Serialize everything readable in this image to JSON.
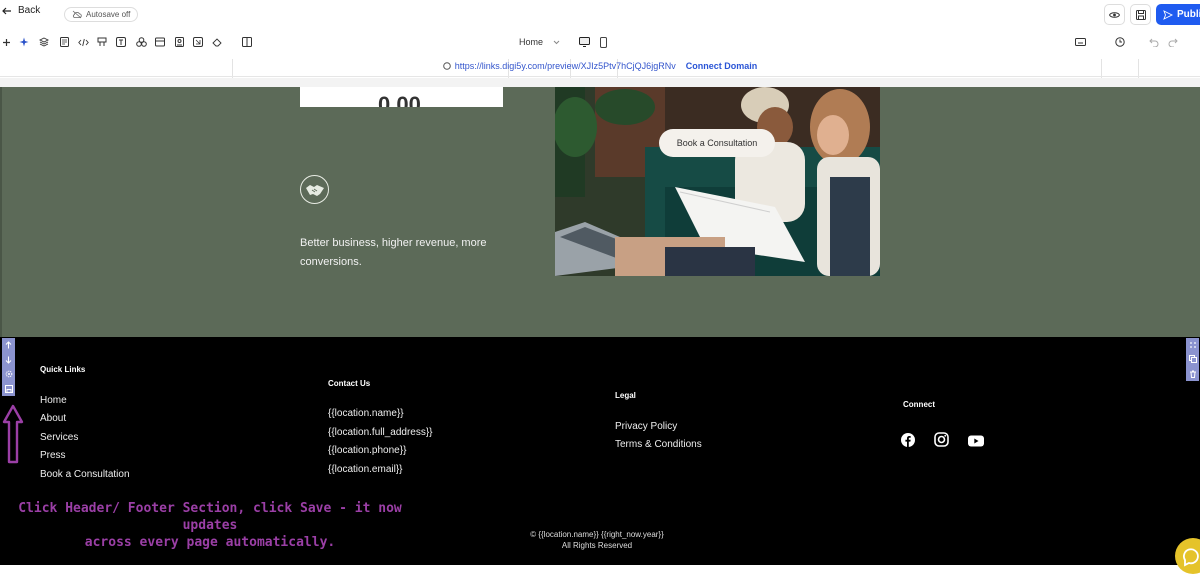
{
  "topbar": {
    "back_label": "Back",
    "autosave_label": "Autosave off",
    "publish_label": "Publi"
  },
  "toolbar": {
    "page_select": "Home"
  },
  "urlbar": {
    "url": "https://links.digi5y.com/preview/XJIz5Ptv7hCjQJ6jgRNv",
    "connect_label": "Connect Domain"
  },
  "content": {
    "price_partial": "0.00",
    "tagline": "Better business, higher revenue, more conversions.",
    "book_button": "Book a Consultation"
  },
  "footer": {
    "quick_links_heading": "Quick Links",
    "quick_links": [
      "Home",
      "About",
      "Services",
      "Press",
      "Book a Consultation"
    ],
    "contact_heading": "Contact Us",
    "contact_lines": [
      "{{location.name}}",
      "{{location.full_address}}",
      "{{location.phone}}",
      "{{location.email}}"
    ],
    "legal_heading": "Legal",
    "legal_links": [
      "Privacy Policy",
      "Terms & Conditions"
    ],
    "connect_heading": "Connect",
    "copyright_line1": "© {{location.name}} {{right_now.year}}",
    "copyright_line2": "All Rights Reserved"
  },
  "annotation": {
    "line1": "Click Header/ Footer Section, click Save - it now updates",
    "line2": "across every page automatically."
  },
  "colors": {
    "accent": "#1f5bf0",
    "section_green": "#5c6a58",
    "annotation_purple": "#9b3fa6",
    "footer_bg": "#000000"
  }
}
